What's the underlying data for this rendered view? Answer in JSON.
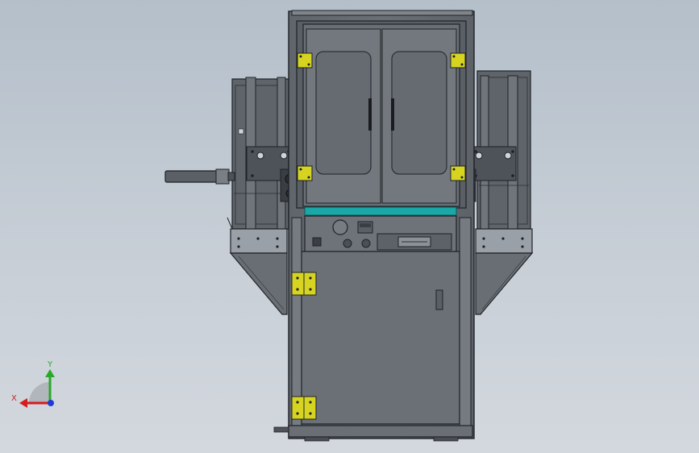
{
  "axis_triad": {
    "x_label": "X",
    "y_label": "Y",
    "x_color": "#d21e1e",
    "y_color": "#2aa82a",
    "z_color": "#1e3cd2"
  },
  "colors": {
    "background_top": "#b4bfca",
    "background_bottom": "#d3d8de",
    "body_dark": "#5a5f66",
    "body_mid": "#6c7178",
    "body_light": "#9aa0a8",
    "frame_outline": "#1e2226",
    "accent_strip": "#1aa7a7",
    "hinge_yellow": "#d7d421"
  }
}
